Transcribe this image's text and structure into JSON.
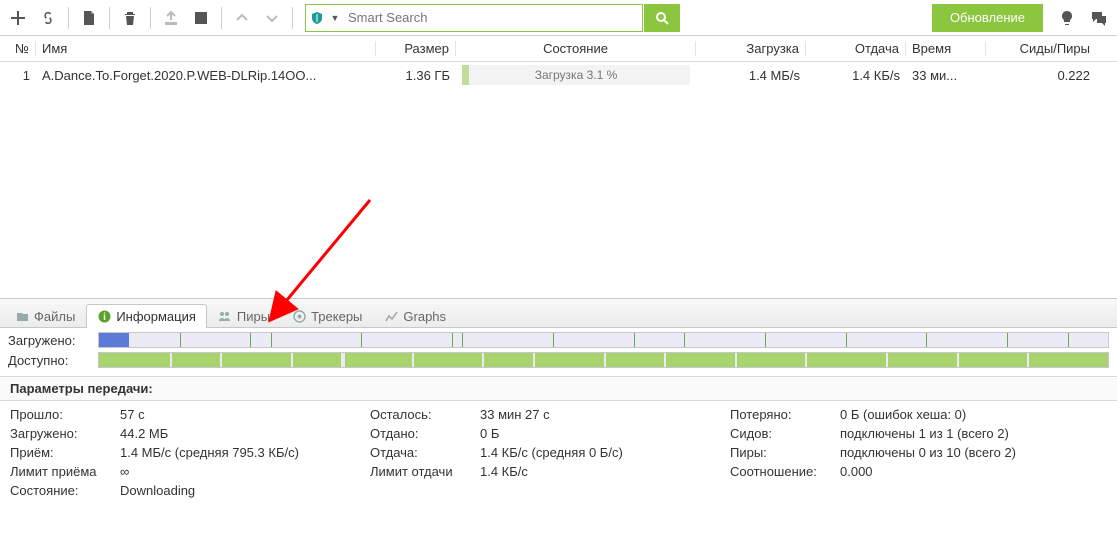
{
  "toolbar": {
    "update_label": "Обновление"
  },
  "search": {
    "placeholder": "Smart Search"
  },
  "columns": {
    "num": "№",
    "name": "Имя",
    "size": "Размер",
    "state": "Состояние",
    "download": "Загрузка",
    "upload": "Отдача",
    "time": "Время",
    "ratio": "Сиды/Пиры"
  },
  "torrents": [
    {
      "num": "1",
      "name": "A.Dance.To.Forget.2020.P.WEB-DLRip.14OO...",
      "size": "1.36 ГБ",
      "state": "Загрузка 3.1 %",
      "download": "1.4 МБ/s",
      "upload": "1.4 КБ/s",
      "time": "33 ми...",
      "ratio": "0.222"
    }
  ],
  "tabs": {
    "files": "Файлы",
    "info": "Информация",
    "peers": "Пиры",
    "trackers": "Трекеры",
    "graphs": "Graphs"
  },
  "piece_labels": {
    "loaded": "Загружено:",
    "avail": "Доступно:"
  },
  "stats_header": "Параметры передачи:",
  "stats": {
    "elapsed_l": "Прошло:",
    "elapsed_v": "57 с",
    "down_l": "Загружено:",
    "down_v": "44.2 МБ",
    "recv_l": "Приём:",
    "recv_v": "1.4 МБ/с (средняя 795.3 КБ/с)",
    "dlim_l": "Лимит приёма",
    "dlim_v": "∞",
    "state_l": "Состояние:",
    "state_v": "Downloading",
    "remain_l": "Осталось:",
    "remain_v": "33 мин 27 с",
    "up_l": "Отдано:",
    "up_v": "0 Б",
    "send_l": "Отдача:",
    "send_v": "1.4 КБ/с (средняя 0 Б/с)",
    "ulim_l": "Лимит отдачи",
    "ulim_v": "1.4 КБ/с",
    "lost_l": "Потеряно:",
    "lost_v": "0 Б (ошибок хеша: 0)",
    "seeds_l": "Сидов:",
    "seeds_v": "подключены 1 из 1 (всего 2)",
    "peers_l": "Пиры:",
    "peers_v": "подключены 0 из 10 (всего 2)",
    "ratio_l": "Соотношение:",
    "ratio_v": "0.000"
  }
}
